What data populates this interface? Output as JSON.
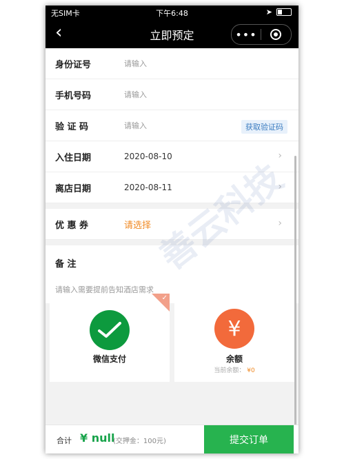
{
  "status": {
    "carrier": "无SIM卡",
    "time": "下午6:48"
  },
  "nav": {
    "title": "立即预定",
    "back_icon": "chevron-left-icon",
    "more_icon": "more-dots-icon",
    "close_icon": "target-icon"
  },
  "form": {
    "id_label": "身份证号",
    "id_placeholder": "请输入",
    "phone_label": "手机号码",
    "phone_placeholder": "请输入",
    "code_label": "验 证 码",
    "code_placeholder": "请输入",
    "code_button": "获取验证码",
    "checkin_label": "入住日期",
    "checkin_value": "2020-08-10",
    "checkout_label": "离店日期",
    "checkout_value": "2020-08-11",
    "coupon_label": "优 惠 券",
    "coupon_value": "请选择",
    "remark_label": "备    注",
    "remark_placeholder": "请输入需要提前告知酒店需求"
  },
  "payment": {
    "wechat_label": "微信支付",
    "balance_label": "余额",
    "balance_note_prefix": "当前余额：",
    "balance_amount": "¥0",
    "selected": "wechat"
  },
  "footer": {
    "total_label": "合计",
    "amount": "¥ null",
    "deposit": "(交押金：100元)",
    "submit_label": "提交订单"
  },
  "watermark": "善云科技",
  "colors": {
    "accent_green": "#27b34f",
    "wechat_green": "#0d9a3e",
    "balance_orange": "#f26a3b",
    "link_orange": "#f08a24"
  }
}
